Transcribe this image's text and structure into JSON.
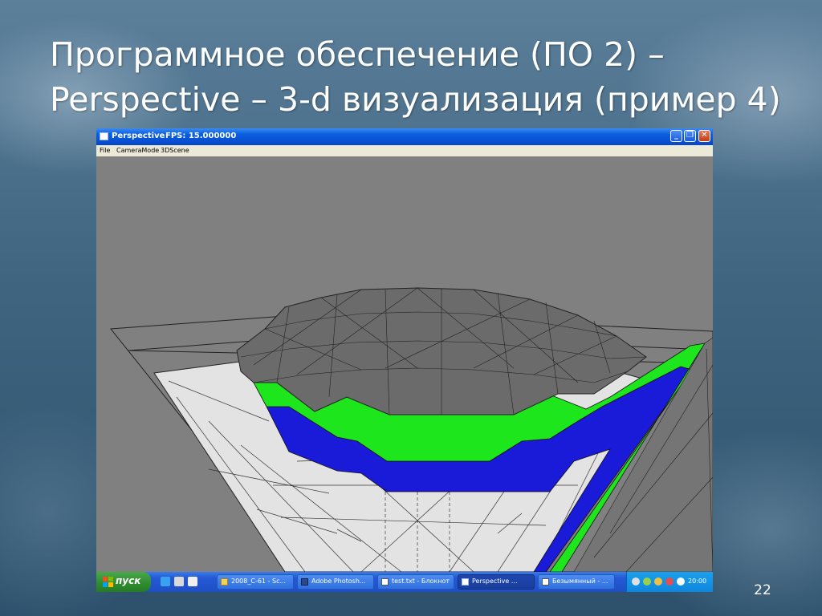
{
  "slide": {
    "title_line1": "Программное обеспечение (ПО 2) –",
    "title_line2": "Perspective – 3-d визуализация (пример 4)",
    "page_number": "22"
  },
  "window": {
    "title": "Perspective",
    "fps": "FPS: 15.000000",
    "minimize_glyph": "_",
    "maximize_glyph": "❐",
    "close_glyph": "✕"
  },
  "menu": {
    "items": [
      "File",
      "CameraMode",
      "3DScene"
    ]
  },
  "scene": {
    "colors": {
      "background": "#808080",
      "dome": "#6b6b6b",
      "plaza": "#e3e3e3",
      "green_band": "#1de61d",
      "blue_band": "#1a1ad9",
      "wireframe": "#222222"
    }
  },
  "taskbar": {
    "start_label": "пуск",
    "tasks": [
      "2008_C-61 - Sc...",
      "Adobe Photosh...",
      "test.txt - Блокнот",
      "Perspective     ...",
      "Безымянный - ..."
    ],
    "active_task": "Perspective     ...",
    "clock": "20:00"
  },
  "icons": {
    "app": "window-icon",
    "start": "windows-flag-icon",
    "tray": [
      "speaker-icon",
      "network-icon",
      "antivirus-icon",
      "update-icon"
    ]
  }
}
